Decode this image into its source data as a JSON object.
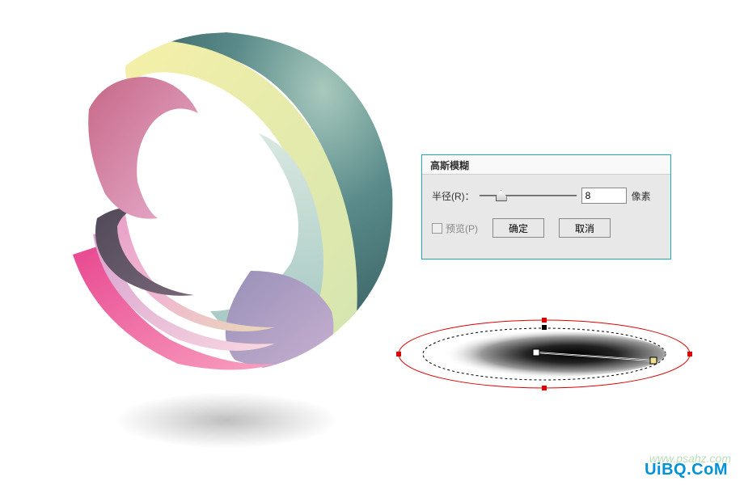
{
  "dialog": {
    "title": "高斯模糊",
    "radius_label": "半径(R)：",
    "radius_value": "8",
    "unit": "像素",
    "preview_label": "预览(P)",
    "ok": "确定",
    "cancel": "取消"
  },
  "watermark": {
    "main": "UiBQ.CoM",
    "sub": "www.psahz.com"
  }
}
